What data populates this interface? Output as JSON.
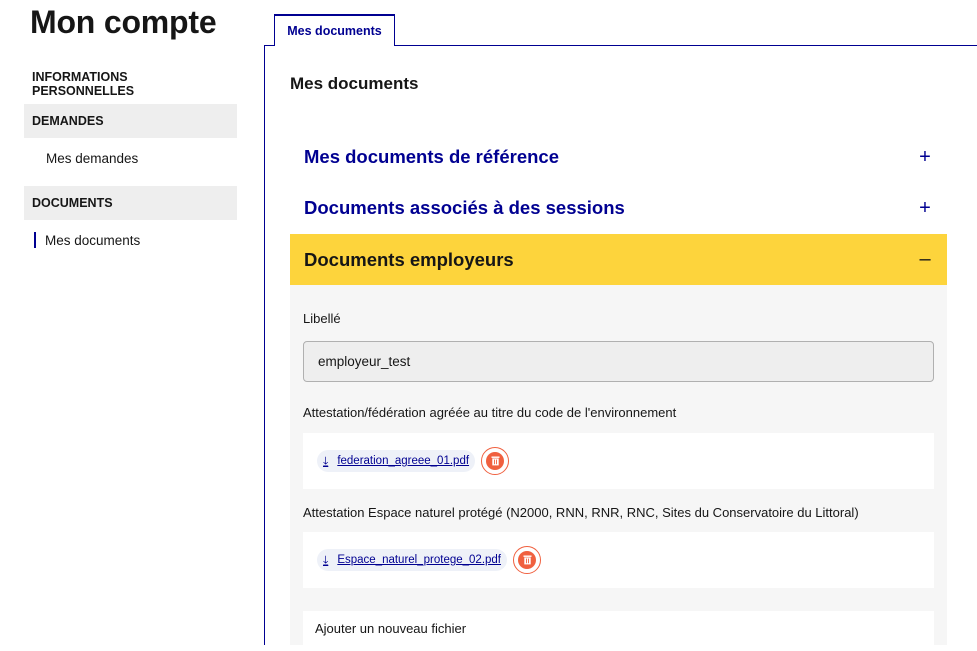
{
  "page": {
    "title": "Mon compte"
  },
  "sidebar": {
    "sections": [
      {
        "label": "INFORMATIONS PERSONNELLES"
      },
      {
        "label": "DEMANDES",
        "items": [
          {
            "label": "Mes demandes"
          }
        ]
      },
      {
        "label": "DOCUMENTS",
        "items": [
          {
            "label": "Mes documents",
            "active": true
          }
        ]
      }
    ]
  },
  "tabs": [
    {
      "label": "Mes documents",
      "selected": true
    }
  ],
  "panel": {
    "title": "Mes documents",
    "accordions": [
      {
        "label": "Mes documents de référence",
        "sign": "+",
        "expanded": false
      },
      {
        "label": "Documents associés à des sessions",
        "sign": "+",
        "expanded": false
      },
      {
        "label": "Documents employeurs",
        "sign": "–",
        "expanded": true
      }
    ],
    "employer": {
      "libelle_label": "Libellé",
      "libelle_value": "employeur_test",
      "attestations": [
        {
          "label": "Attestation/fédération agréée au titre du code de l'environnement",
          "file": "federation_agreee_01.pdf"
        },
        {
          "label": "Attestation Espace naturel protégé (N2000, RNN, RNR, RNC, Sites du Conservatoire du Littoral)",
          "file": "Espace_naturel_protege_02.pdf"
        }
      ],
      "add_file_label": "Ajouter un nouveau fichier"
    }
  },
  "colors": {
    "accent": "#000091",
    "open_accordion": "#fdd43c",
    "delete": "#f0603f"
  },
  "icons": {
    "download": "download-icon",
    "delete": "trash-icon"
  }
}
